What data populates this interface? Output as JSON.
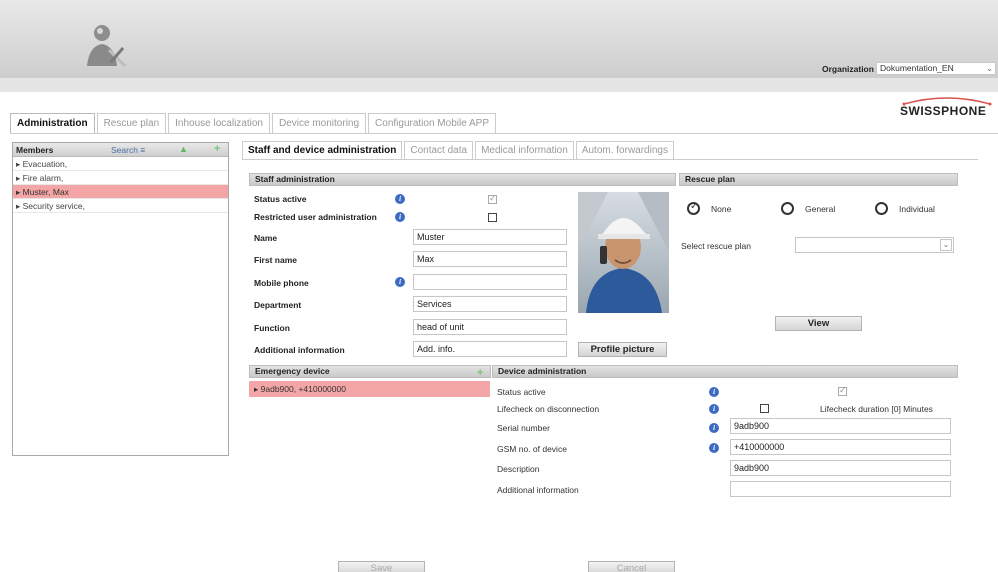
{
  "header": {
    "organization_label": "Organization",
    "organization_value": "Dokumentation_EN",
    "brand": "SWISSPHONE"
  },
  "main_tabs": [
    {
      "label": "Administration",
      "active": true
    },
    {
      "label": "Rescue plan",
      "active": false
    },
    {
      "label": "Inhouse localization",
      "active": false
    },
    {
      "label": "Device monitoring",
      "active": false
    },
    {
      "label": "Configuration Mobile APP",
      "active": false
    }
  ],
  "members": {
    "title": "Members",
    "search_label": "Search",
    "items": [
      {
        "label": "Evacuation,",
        "selected": false
      },
      {
        "label": "Fire alarm,",
        "selected": false
      },
      {
        "label": "Muster, Max",
        "selected": true
      },
      {
        "label": "Security service,",
        "selected": false
      }
    ]
  },
  "sub_tabs": [
    {
      "label": "Staff and device administration",
      "active": true
    },
    {
      "label": "Contact data",
      "active": false
    },
    {
      "label": "Medical information",
      "active": false
    },
    {
      "label": "Autom. forwardings",
      "active": false
    }
  ],
  "staff": {
    "title": "Staff administration",
    "status_active_label": "Status active",
    "status_active_checked": true,
    "restricted_label": "Restricted user administration",
    "restricted_checked": false,
    "name_label": "Name",
    "name_value": "Muster",
    "first_name_label": "First name",
    "first_name_value": "Max",
    "mobile_label": "Mobile phone",
    "mobile_value": "",
    "department_label": "Department",
    "department_value": "Services",
    "function_label": "Function",
    "function_value": "head of unit",
    "additional_label": "Additional information",
    "additional_value": "Add. info.",
    "profile_button": "Profile picture"
  },
  "rescue_plan": {
    "title": "Rescue plan",
    "options": [
      "None",
      "General",
      "Individual"
    ],
    "selected": "None",
    "select_label": "Select rescue plan",
    "select_value": "",
    "view_button": "View"
  },
  "emergency": {
    "title": "Emergency device",
    "items": [
      "9adb900, +410000000"
    ]
  },
  "device": {
    "title": "Device administration",
    "status_label": "Status active",
    "status_checked": true,
    "lifecheck_label": "Lifecheck on disconnection",
    "lifecheck_checked": false,
    "lifecheck_duration_text": "Lifecheck duration [0] Minutes",
    "serial_label": "Serial number",
    "serial_value": "9adb900",
    "gsm_label": "GSM no. of device",
    "gsm_value": "+410000000",
    "description_label": "Description",
    "description_value": "9adb900",
    "additional_label": "Additional information",
    "additional_value": ""
  },
  "footer": {
    "save": "Save",
    "cancel": "Cancel"
  },
  "colors": {
    "selected_row": "#f4a6a6",
    "info_icon": "#3d6bc4"
  }
}
